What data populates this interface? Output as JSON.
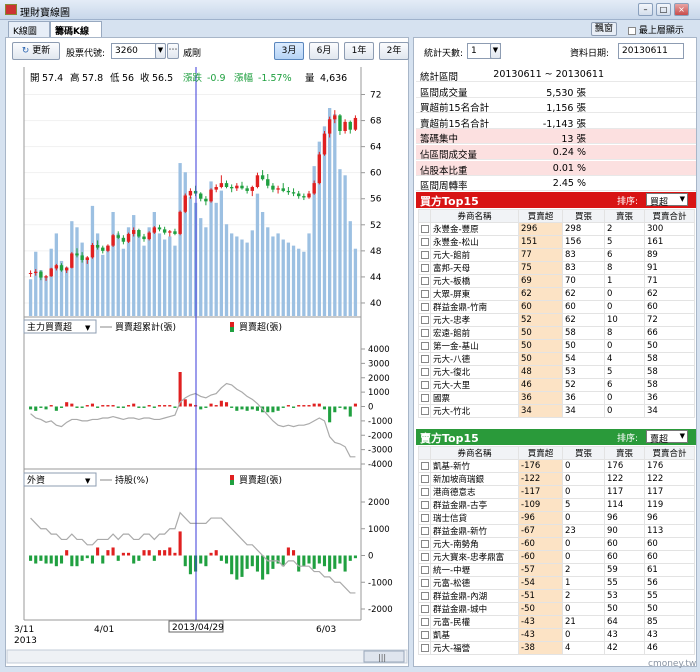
{
  "window": {
    "title": "理財寶線圖"
  },
  "tabs": [
    {
      "label": "K線圖"
    },
    {
      "label": "籌碼K線圖"
    }
  ],
  "topbar": {
    "mode_button": "飄窗",
    "always_on_top": "最上層顯示"
  },
  "toolbar": {
    "refresh": "更新",
    "stock_code_label": "股票代號:",
    "stock_code": "3260",
    "stock_name": "威剛",
    "ranges": [
      "3月",
      "6月",
      "1年",
      "2年"
    ],
    "active_range": "3月"
  },
  "right_controls": {
    "days_label": "統計天數:",
    "days_value": "1",
    "date_label": "資料日期:",
    "date_value": "20130611"
  },
  "stats": [
    {
      "label": "統計區間",
      "value": "20130611 ~ 20130611"
    },
    {
      "label": "區間成交量",
      "value": "5,530 張"
    },
    {
      "label": "買超前15名合計",
      "value": "1,156 張"
    },
    {
      "label": "賣超前15名合計",
      "value": "-1,143 張"
    },
    {
      "label": "籌碼集中",
      "value": "13 張"
    },
    {
      "label": "佔區間成交量",
      "value": "0.24 %"
    },
    {
      "label": "佔股本比重",
      "value": "0.01 %"
    },
    {
      "label": "區間周轉率",
      "value": "2.45 %"
    }
  ],
  "buy_table": {
    "title": "買方Top15",
    "sort_label": "排序:",
    "sort_value": "買超",
    "headers": [
      "券商名稱",
      "買賣超",
      "買張",
      "賣張",
      "買賣合計"
    ],
    "rows": [
      [
        "永豐金-豐原",
        "296",
        "298",
        "2",
        "300"
      ],
      [
        "永豐金-松山",
        "151",
        "156",
        "5",
        "161"
      ],
      [
        "元大-館前",
        "77",
        "83",
        "6",
        "89"
      ],
      [
        "富邦-天母",
        "75",
        "83",
        "8",
        "91"
      ],
      [
        "元大-板橋",
        "69",
        "70",
        "1",
        "71"
      ],
      [
        "大眾-屏東",
        "62",
        "62",
        "0",
        "62"
      ],
      [
        "群益金鼎-竹南",
        "60",
        "60",
        "0",
        "60"
      ],
      [
        "元大-忠孝",
        "52",
        "62",
        "10",
        "72"
      ],
      [
        "宏遠-館前",
        "50",
        "58",
        "8",
        "66"
      ],
      [
        "第一金-基山",
        "50",
        "50",
        "0",
        "50"
      ],
      [
        "元大-八德",
        "50",
        "54",
        "4",
        "58"
      ],
      [
        "元大-復北",
        "48",
        "53",
        "5",
        "58"
      ],
      [
        "元大-大里",
        "46",
        "52",
        "6",
        "58"
      ],
      [
        "國票",
        "36",
        "36",
        "0",
        "36"
      ],
      [
        "元大-竹北",
        "34",
        "34",
        "0",
        "34"
      ]
    ]
  },
  "sell_table": {
    "title": "賣方Top15",
    "sort_label": "排序:",
    "sort_value": "賣超",
    "headers": [
      "券商名稱",
      "買賣超",
      "買張",
      "賣張",
      "買賣合計"
    ],
    "rows": [
      [
        "凱基-新竹",
        "-176",
        "0",
        "176",
        "176"
      ],
      [
        "新加坡商瑞銀",
        "-122",
        "0",
        "122",
        "122"
      ],
      [
        "港商德意志",
        "-117",
        "0",
        "117",
        "117"
      ],
      [
        "群益金鼎-古亭",
        "-109",
        "5",
        "114",
        "119"
      ],
      [
        "瑞士信貸",
        "-96",
        "0",
        "96",
        "96"
      ],
      [
        "群益金鼎-新竹",
        "-67",
        "23",
        "90",
        "113"
      ],
      [
        "元大-南勢角",
        "-60",
        "0",
        "60",
        "60"
      ],
      [
        "元大寶來-忠孝鼎富",
        "-60",
        "0",
        "60",
        "60"
      ],
      [
        "統一-中壢",
        "-57",
        "2",
        "59",
        "61"
      ],
      [
        "元富-松德",
        "-54",
        "1",
        "55",
        "56"
      ],
      [
        "群益金鼎-內湖",
        "-51",
        "2",
        "53",
        "55"
      ],
      [
        "群益金鼎-城中",
        "-50",
        "0",
        "50",
        "50"
      ],
      [
        "元富-民權",
        "-43",
        "21",
        "64",
        "85"
      ],
      [
        "凱基",
        "-43",
        "0",
        "43",
        "43"
      ],
      [
        "元大-福營",
        "-38",
        "4",
        "42",
        "46"
      ]
    ]
  },
  "chart_info": {
    "open_label": "開",
    "open": "57.4",
    "high_label": "高",
    "high": "57.8",
    "low_label": "低",
    "low": "56",
    "close_label": "收",
    "close": "56.5",
    "chg_label": "漲跌",
    "chg": "-0.9",
    "pct_label": "漲幅",
    "pct": "-1.57%",
    "vol_label": "量",
    "vol": "4,636"
  },
  "panel2": {
    "dropdown": "主力買賣超",
    "line_legend": "買賣超累計(張)",
    "bar_legend": "買賣超(張)"
  },
  "panel3": {
    "dropdown": "外資",
    "line_legend": "持股(%)",
    "bar_legend": "買賣超(張)"
  },
  "dates": {
    "d1": "3/11",
    "d1y": "2013",
    "d2": "4/01",
    "d3": "6/03",
    "cursor": "2013/04/29"
  },
  "footer": {
    "watermark": "cmoney.tw"
  },
  "colors": {
    "up": "#e02020",
    "down": "#20a040",
    "volume": "#9cc0e2",
    "buy_header": "#d81414",
    "sell_header": "#2a9a3a",
    "highlight": "#fce3c5"
  },
  "chart_data": [
    {
      "type": "candlestick",
      "title": "",
      "ylim": [
        38,
        73
      ],
      "yticks": [
        40,
        44,
        48,
        52,
        56,
        60,
        64,
        68,
        72
      ],
      "xlabels": [
        "3/11",
        "4/01",
        "6/03"
      ],
      "ohlc": [
        [
          44.5,
          45,
          44,
          44.6
        ],
        [
          44.6,
          45.2,
          44.2,
          44.8
        ],
        [
          44.8,
          45,
          43.5,
          43.9
        ],
        [
          43.9,
          44.3,
          43.4,
          44.1
        ],
        [
          44.1,
          45.4,
          44,
          45.3
        ],
        [
          45.3,
          46,
          45,
          45.8
        ],
        [
          45.8,
          46.1,
          44.8,
          45
        ],
        [
          45,
          45.6,
          44.6,
          45.4
        ],
        [
          45.4,
          47.8,
          45.3,
          47.6
        ],
        [
          47.6,
          48.4,
          47,
          47.3
        ],
        [
          47.3,
          47.8,
          46.2,
          46.6
        ],
        [
          46.6,
          47.2,
          46,
          47
        ],
        [
          47,
          49.2,
          46.8,
          48.9
        ],
        [
          48.9,
          49.6,
          48.2,
          48.5
        ],
        [
          48.5,
          48.8,
          47.6,
          48
        ],
        [
          48,
          49,
          47.8,
          48.8
        ],
        [
          48.8,
          50.6,
          48.6,
          50.4
        ],
        [
          50.4,
          51,
          49.8,
          50
        ],
        [
          50,
          50.4,
          49,
          49.4
        ],
        [
          49.4,
          50.8,
          49.2,
          50.6
        ],
        [
          50.6,
          51.6,
          50.2,
          51.2
        ],
        [
          51.2,
          51.4,
          50,
          50.2
        ],
        [
          50.2,
          50.6,
          49.4,
          49.8
        ],
        [
          49.8,
          51,
          49.6,
          50.8
        ],
        [
          50.8,
          51.8,
          50.6,
          51.6
        ],
        [
          51.6,
          52,
          51,
          51.3
        ],
        [
          51.3,
          51.7,
          50.5,
          50.8
        ],
        [
          50.8,
          51.2,
          50.2,
          51
        ],
        [
          51,
          51.4,
          50.4,
          50.6
        ],
        [
          50.6,
          54.2,
          50.4,
          54
        ],
        [
          54,
          56.8,
          53.8,
          56.5
        ],
        [
          56.5,
          57.6,
          56,
          57.2
        ],
        [
          57.2,
          58,
          56.4,
          56.8
        ],
        [
          56.8,
          57,
          55.6,
          56
        ],
        [
          56,
          56.4,
          55,
          55.6
        ],
        [
          55.6,
          57.6,
          55.4,
          57.4
        ],
        [
          57.4,
          58.2,
          57,
          57.8
        ],
        [
          57.8,
          59.6,
          57.6,
          58.4
        ],
        [
          58.4,
          58.8,
          57.6,
          57.8
        ],
        [
          57.8,
          58.2,
          57,
          57.6
        ],
        [
          57.6,
          58.4,
          57.2,
          58
        ],
        [
          58,
          58.6,
          57.4,
          57.6
        ],
        [
          57.6,
          58,
          56.8,
          57.2
        ],
        [
          57.2,
          58,
          56.4,
          57.8
        ],
        [
          57.8,
          60,
          57.6,
          59.6
        ],
        [
          59.6,
          60.4,
          58.8,
          59
        ],
        [
          59,
          59.8,
          57.6,
          58
        ],
        [
          58,
          58.4,
          57,
          57.4
        ],
        [
          57.4,
          58,
          56.8,
          57.6
        ],
        [
          57.6,
          58.4,
          57,
          57.2
        ],
        [
          57.2,
          57.8,
          56.6,
          57
        ],
        [
          57,
          57.6,
          56.4,
          56.8
        ],
        [
          56.8,
          57.2,
          56,
          56.4
        ],
        [
          56.4,
          56.8,
          55.8,
          56.2
        ],
        [
          56.2,
          57.2,
          56,
          56.8
        ],
        [
          56.8,
          58.8,
          56.6,
          58.4
        ],
        [
          58.4,
          63.2,
          58.2,
          62.8
        ],
        [
          62.8,
          66.4,
          62.6,
          66
        ],
        [
          66,
          68.6,
          65.4,
          68.2
        ],
        [
          68.2,
          69.6,
          67.6,
          68.8
        ],
        [
          68.8,
          69,
          65.8,
          66.4
        ],
        [
          66.4,
          68.2,
          66,
          67.8
        ],
        [
          67.8,
          68,
          66,
          66.6
        ],
        [
          66.6,
          68.8,
          66.4,
          68.4
        ]
      ],
      "volume": [
        1200,
        2100,
        1500,
        1300,
        2200,
        2700,
        1800,
        1600,
        3100,
        2900,
        2400,
        1900,
        3600,
        2700,
        2000,
        2300,
        3400,
        2700,
        2200,
        2900,
        3300,
        2700,
        2300,
        2900,
        3400,
        2700,
        2500,
        2600,
        2300,
        5000,
        4700,
        3900,
        3700,
        3200,
        2900,
        4400,
        3700,
        4100,
        3000,
        2700,
        2600,
        2500,
        2400,
        2800,
        4000,
        3400,
        2900,
        2600,
        2700,
        2500,
        2400,
        2300,
        2200,
        2100,
        2700,
        4900,
        5700,
        6200,
        6800,
        6600,
        4800,
        4600,
        3100,
        2200
      ]
    },
    {
      "type": "bar",
      "series": [
        {
          "name": "買賣超累計(張)",
          "values": [
            -500,
            -800,
            -900,
            -1100,
            -1000,
            -1300,
            -1400,
            -1100,
            -900,
            -900,
            -1000,
            -1000,
            -900,
            -900,
            -800,
            -800,
            -700,
            -800,
            -900,
            -800,
            -800,
            -900,
            -800,
            -800,
            -900,
            -900,
            -800,
            -700,
            -600,
            300,
            600,
            800,
            900,
            700,
            600,
            800,
            900,
            1300,
            1600,
            1500,
            1200,
            1000,
            700,
            500,
            200,
            -200,
            -600,
            -1000,
            -1300,
            -1400,
            -1300,
            -1400,
            -1300,
            -1300,
            -1200,
            -1000,
            -800,
            -1000,
            -2100,
            -2500,
            -2600,
            -2800,
            -3500,
            -3500
          ]
        },
        {
          "name": "買賣超(張)",
          "values": [
            -200,
            -300,
            -100,
            -200,
            100,
            -300,
            -100,
            300,
            200,
            -100,
            -100,
            100,
            200,
            -100,
            100,
            100,
            100,
            -100,
            -100,
            100,
            200,
            -100,
            -100,
            100,
            -100,
            100,
            100,
            100,
            -100,
            2400,
            500,
            200,
            100,
            -200,
            -100,
            200,
            100,
            400,
            300,
            -100,
            -300,
            -200,
            -300,
            -200,
            -300,
            -400,
            -400,
            -400,
            -300,
            -100,
            100,
            -100,
            100,
            100,
            100,
            200,
            200,
            -200,
            -1100,
            -400,
            -100,
            -200,
            -700,
            200
          ]
        }
      ]
    },
    {
      "type": "bar",
      "series": [
        {
          "name": "持股(%)",
          "values": [
            3.5,
            3.4,
            3.3,
            3.3,
            3.2,
            3.2,
            3.1,
            3.1,
            3.2,
            3.1,
            3.1,
            3,
            3,
            3.1,
            3.1,
            3.1,
            3.2,
            3.1,
            3.2,
            3.2,
            3.1,
            3.1,
            3.2,
            3.2,
            3.1,
            3.2,
            3.2,
            3.3,
            3.3,
            3.6,
            3.5,
            3.4,
            3.4,
            3.4,
            3.4,
            3.5,
            3.5,
            3.5,
            3.4,
            3.3,
            3.2,
            3.1,
            3,
            3,
            2.9,
            2.8,
            2.7,
            2.7,
            2.7,
            2.6,
            2.7,
            2.7,
            2.6,
            2.6,
            2.6,
            2.5,
            2.5,
            2.4,
            2.4,
            2.3,
            2.3,
            2.2,
            2.1,
            2.1
          ]
        },
        {
          "name": "買賣超(張)",
          "values": [
            -200,
            -300,
            -200,
            -300,
            -300,
            -400,
            -300,
            200,
            -400,
            -400,
            -200,
            -100,
            -300,
            300,
            -300,
            200,
            300,
            -200,
            100,
            100,
            -300,
            -200,
            200,
            200,
            -200,
            200,
            200,
            300,
            100,
            900,
            -400,
            -700,
            -600,
            -300,
            -400,
            100,
            200,
            -200,
            -300,
            -700,
            -900,
            -800,
            -500,
            -400,
            -600,
            -900,
            -700,
            -500,
            -300,
            -400,
            300,
            200,
            -600,
            -400,
            -300,
            -500,
            -300,
            -400,
            -600,
            -500,
            -300,
            -600,
            -200,
            -100
          ]
        }
      ]
    }
  ]
}
